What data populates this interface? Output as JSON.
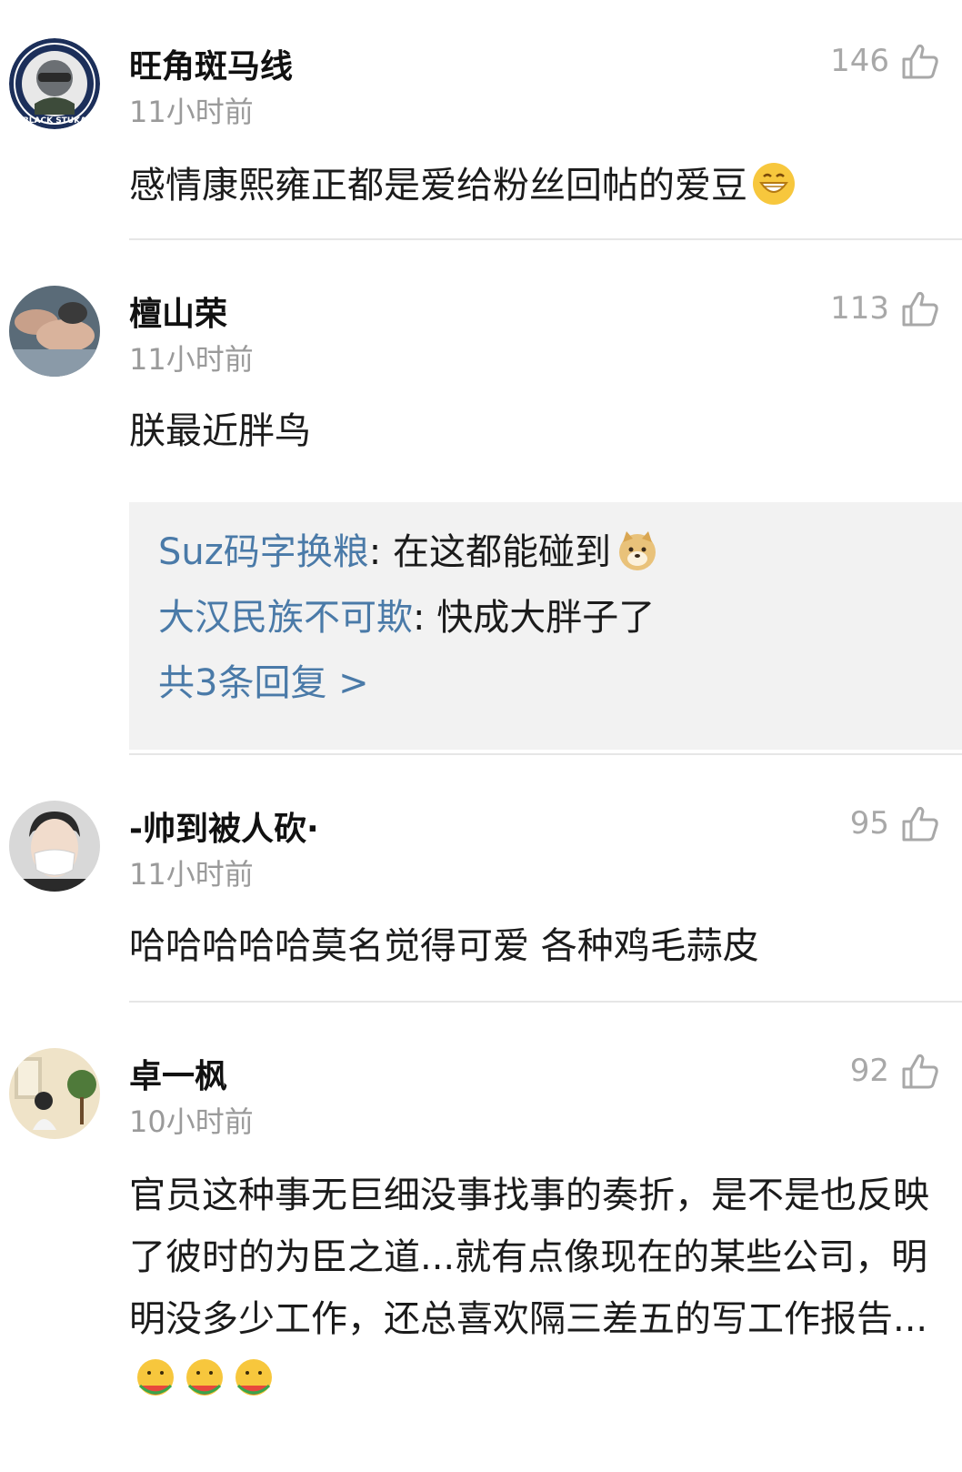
{
  "comments": [
    {
      "username": "旺角斑马线",
      "time": "11小时前",
      "likes": "146",
      "text": "感情康熙雍正都是爱给粉丝回帖的爱豆",
      "avatar_icon": "pilot-mascot-avatar",
      "avatar_text": "BLACK STUKA"
    },
    {
      "username": "檀山荣",
      "time": "11小时前",
      "likes": "113",
      "text": "朕最近胖鸟",
      "avatar_icon": "person-photo-avatar"
    },
    {
      "username": "-帅到被人砍·",
      "time": "11小时前",
      "likes": "95",
      "text": "哈哈哈哈哈莫名觉得可爱 各种鸡毛蒜皮",
      "avatar_icon": "masked-person-avatar"
    },
    {
      "username": "卓一枫",
      "time": "10小时前",
      "likes": "92",
      "text": "官员这种事无巨细没事找事的奏折，是不是也反映了彼时的为臣之道...就有点像现在的某些公司，明明没多少工作，还总喜欢隔三差五的写工作报告...",
      "avatar_icon": "room-photo-avatar"
    }
  ],
  "replies": {
    "items": [
      {
        "user": "Suz码字换粮",
        "separator": ": ",
        "text": "在这都能碰到"
      },
      {
        "user": "大汉民族不可欺",
        "separator": ": ",
        "text": "快成大胖子了"
      }
    ],
    "more_label": "共3条回复 >"
  },
  "colors": {
    "link_blue": "#4a7aa8",
    "timestamp_gray": "#9a9a9a",
    "reply_bg": "#f2f2f2"
  }
}
